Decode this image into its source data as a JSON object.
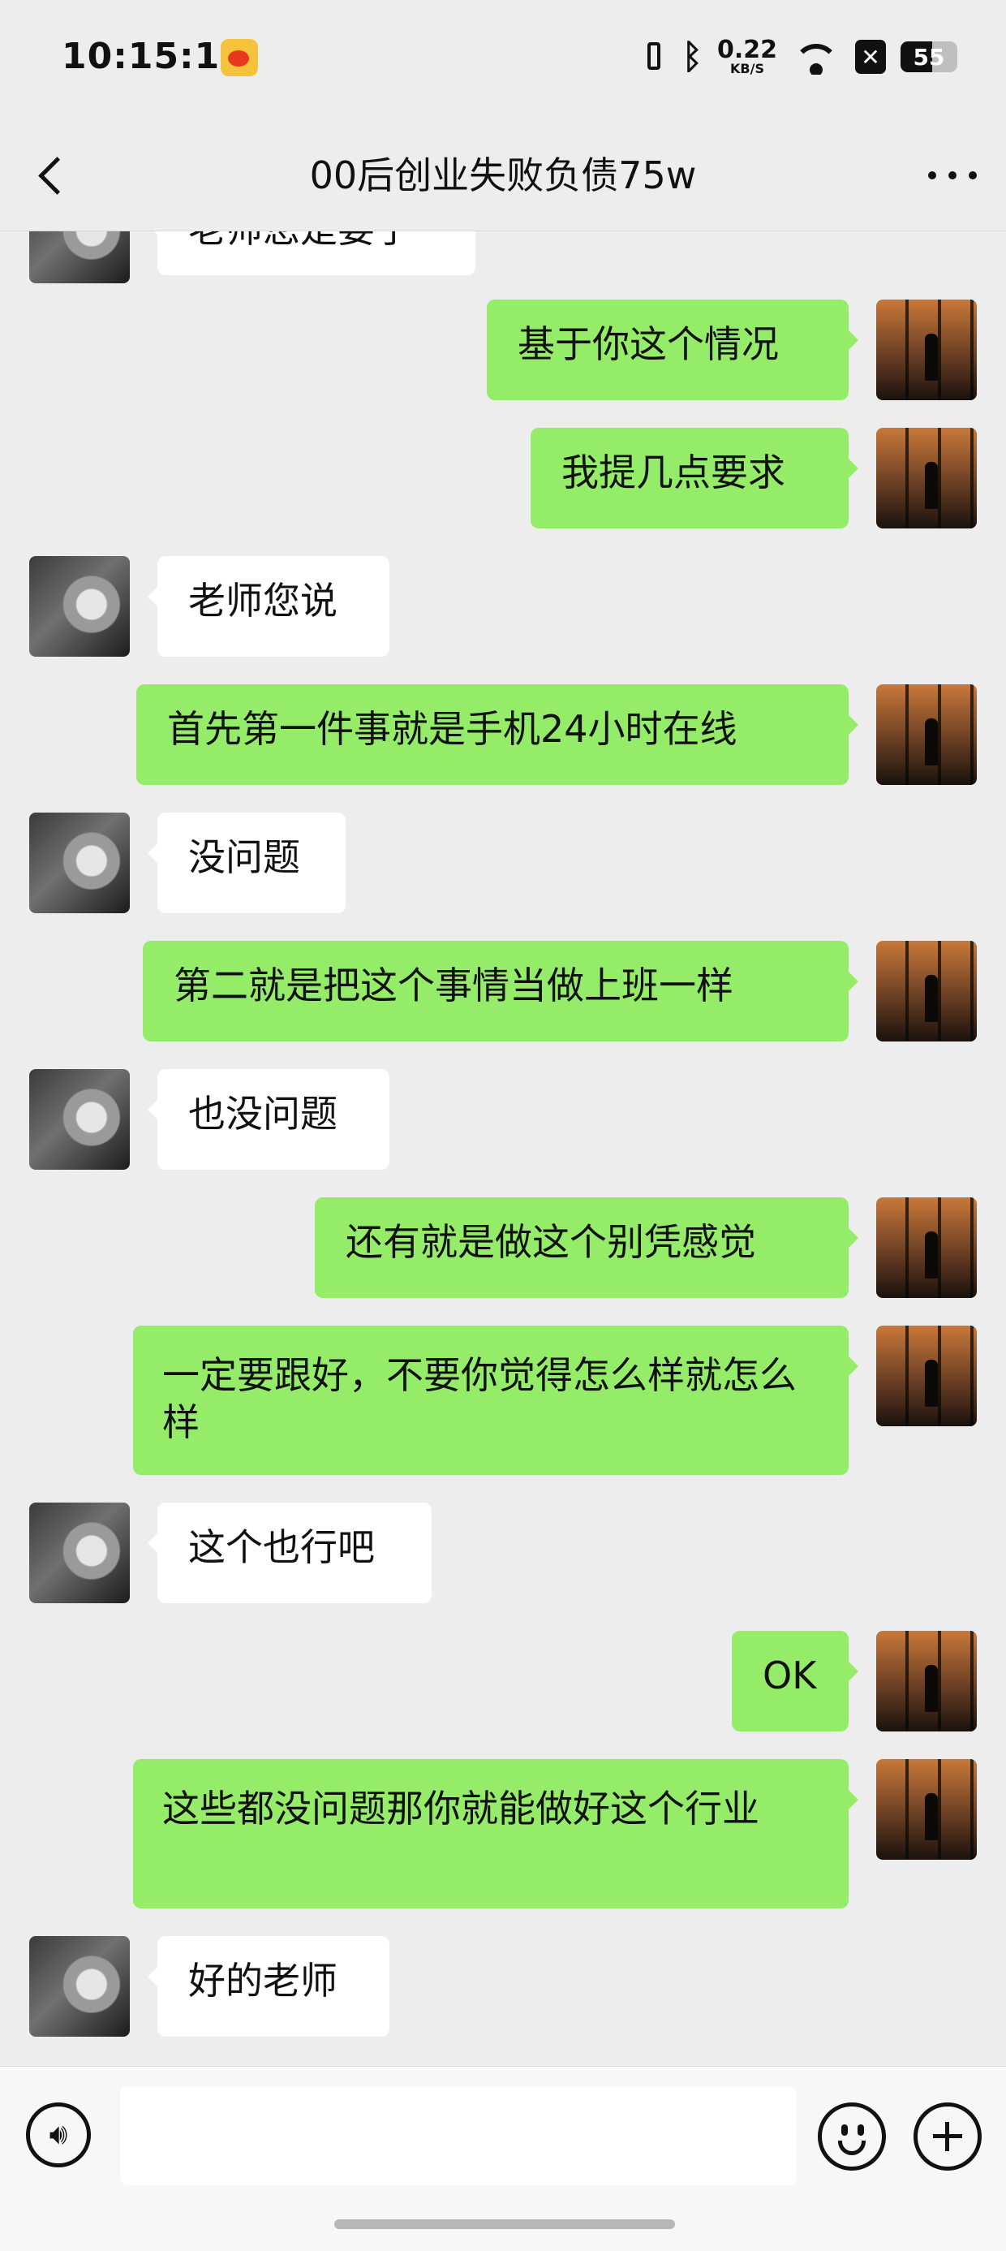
{
  "status_bar": {
    "time": "10:15:10",
    "net_speed": "0.22",
    "net_unit": "KB/S",
    "battery": "55",
    "battery_level_percent": 55,
    "icons": [
      "weibo-icon",
      "vibrate-icon",
      "bluetooth-icon",
      "wifi-icon",
      "no-sim-icon",
      "battery-icon"
    ]
  },
  "header": {
    "title": "00后创业失败负债75w"
  },
  "messages": [
    {
      "side": "left",
      "text": "老师您是要了"
    },
    {
      "side": "right",
      "text": "基于你这个情况"
    },
    {
      "side": "right",
      "text": "我提几点要求"
    },
    {
      "side": "left",
      "text": "老师您说"
    },
    {
      "side": "right",
      "text": "首先第一件事就是手机24小时在线"
    },
    {
      "side": "left",
      "text": "没问题"
    },
    {
      "side": "right",
      "text": "第二就是把这个事情当做上班一样"
    },
    {
      "side": "left",
      "text": "也没问题"
    },
    {
      "side": "right",
      "text": "还有就是做这个别凭感觉"
    },
    {
      "side": "right",
      "text": "一定要跟好，不要你觉得怎么样就怎么样"
    },
    {
      "side": "left",
      "text": "这个也行吧"
    },
    {
      "side": "right",
      "text": "OK"
    },
    {
      "side": "right",
      "text": "这些都没问题那你就能做好这个行业"
    },
    {
      "side": "left",
      "text": "好的老师"
    }
  ],
  "input_bar": {
    "text_value": "",
    "icons": [
      "voice-icon",
      "emoji-icon",
      "plus-icon"
    ]
  },
  "colors": {
    "background": "#ededed",
    "sent_bubble": "#95ec69",
    "received_bubble": "#ffffff"
  }
}
